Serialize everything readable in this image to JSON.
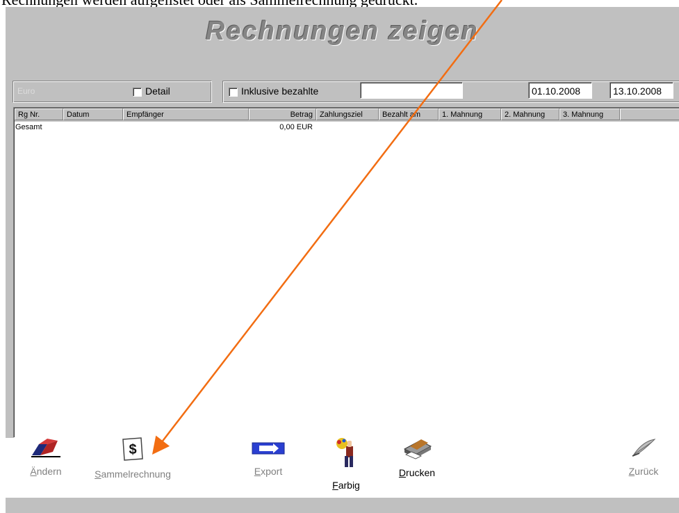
{
  "caption_fragment": "Rechnungen werden aufgelistet oder als Sammelrechnung gedruckt.",
  "window": {
    "title": "Rechnungen zeigen"
  },
  "filters": {
    "currency": "Euro",
    "detail_label": "Detail",
    "detail_checked": false,
    "inclusive_label": "Inklusive bezahlte",
    "inclusive_checked": false,
    "search_value": "",
    "date_from": "01.10.2008",
    "date_to": "13.10.2008"
  },
  "table": {
    "columns": [
      "Rg Nr.",
      "Datum",
      "Empfänger",
      "Betrag",
      "Zahlungsziel",
      "Bezahlt am",
      "1. Mahnung",
      "2. Mahnung",
      "3. Mahnung"
    ],
    "rows": [
      {
        "label": "Gesamt",
        "amount": "0,00 EUR"
      }
    ]
  },
  "toolbar": {
    "edit": {
      "label": "Ändern",
      "icon": "eraser-icon",
      "enabled": false
    },
    "batch": {
      "label": "Sammelrechnung",
      "icon": "dollar-bill-icon",
      "enabled": false
    },
    "export": {
      "label": "Export",
      "icon": "arrow-right-icon",
      "enabled": false
    },
    "color": {
      "label": "Farbig",
      "icon": "painter-icon",
      "enabled": true
    },
    "print": {
      "label": "Drucken",
      "icon": "printer-icon",
      "enabled": true
    },
    "back": {
      "label": "Zurück",
      "icon": "quill-icon",
      "enabled": false
    }
  },
  "colors": {
    "window_bg": "#c0c0c0",
    "annotation_arrow": "#f26d12",
    "title_gray": "#858585"
  }
}
